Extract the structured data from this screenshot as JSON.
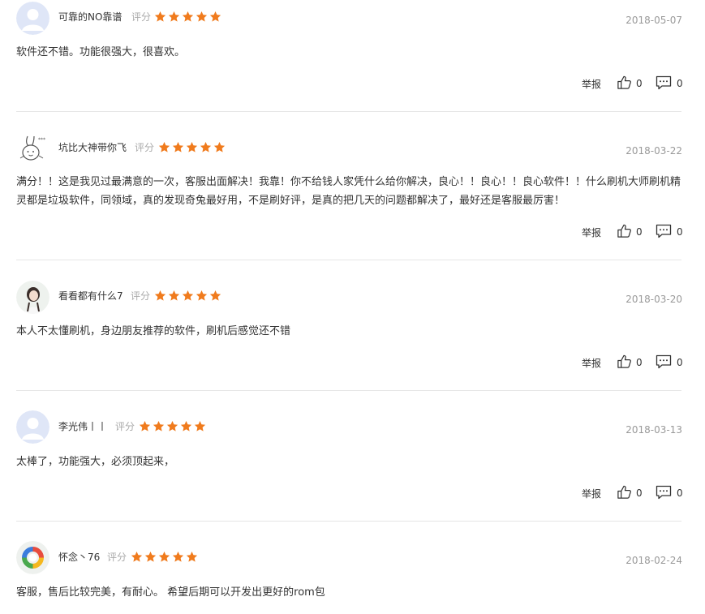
{
  "labels": {
    "rating": "评分",
    "report": "举报"
  },
  "colors": {
    "star": "#f07b1d",
    "default_avatar_bg": "#dfe6f7",
    "default_avatar_fg": "#ffffff"
  },
  "reviews": [
    {
      "username": "可靠的NO靠谱",
      "avatar": "default-avatar",
      "stars": 5,
      "date": "2018-05-07",
      "content": "软件还不错。功能很强大，很喜欢。",
      "likes": "0",
      "comments": "0"
    },
    {
      "username": "坑比大神带你飞",
      "avatar": "cartoon-rabbit-avatar",
      "stars": 5,
      "date": "2018-03-22",
      "content": "满分！！这是我见过最满意的一次，客服出面解决！我靠！你不给钱人家凭什么给你解决，良心！！良心！！良心软件！！什么刷机大师刷机精灵都是垃圾软件，同领域，真的发现奇兔最好用，不是刷好评，是真的把几天的问题都解决了，最好还是客服最厉害！",
      "likes": "0",
      "comments": "0"
    },
    {
      "username": "看看都有什么7",
      "avatar": "girl-photo-avatar",
      "stars": 5,
      "date": "2018-03-20",
      "content": "本人不太懂刷机，身边朋友推荐的软件，刷机后感觉还不错",
      "likes": "0",
      "comments": "0"
    },
    {
      "username": "李光伟丨丨",
      "avatar": "default-avatar",
      "stars": 5,
      "date": "2018-03-13",
      "content": "太棒了，功能强大，必须顶起来，",
      "likes": "0",
      "comments": "0"
    },
    {
      "username": "怀念丶76",
      "avatar": "colorful-logo-avatar",
      "stars": 5,
      "date": "2018-02-24",
      "content": "客服，售后比较完美，有耐心。 希望后期可以开发出更好的rom包",
      "likes": "",
      "comments": ""
    }
  ]
}
